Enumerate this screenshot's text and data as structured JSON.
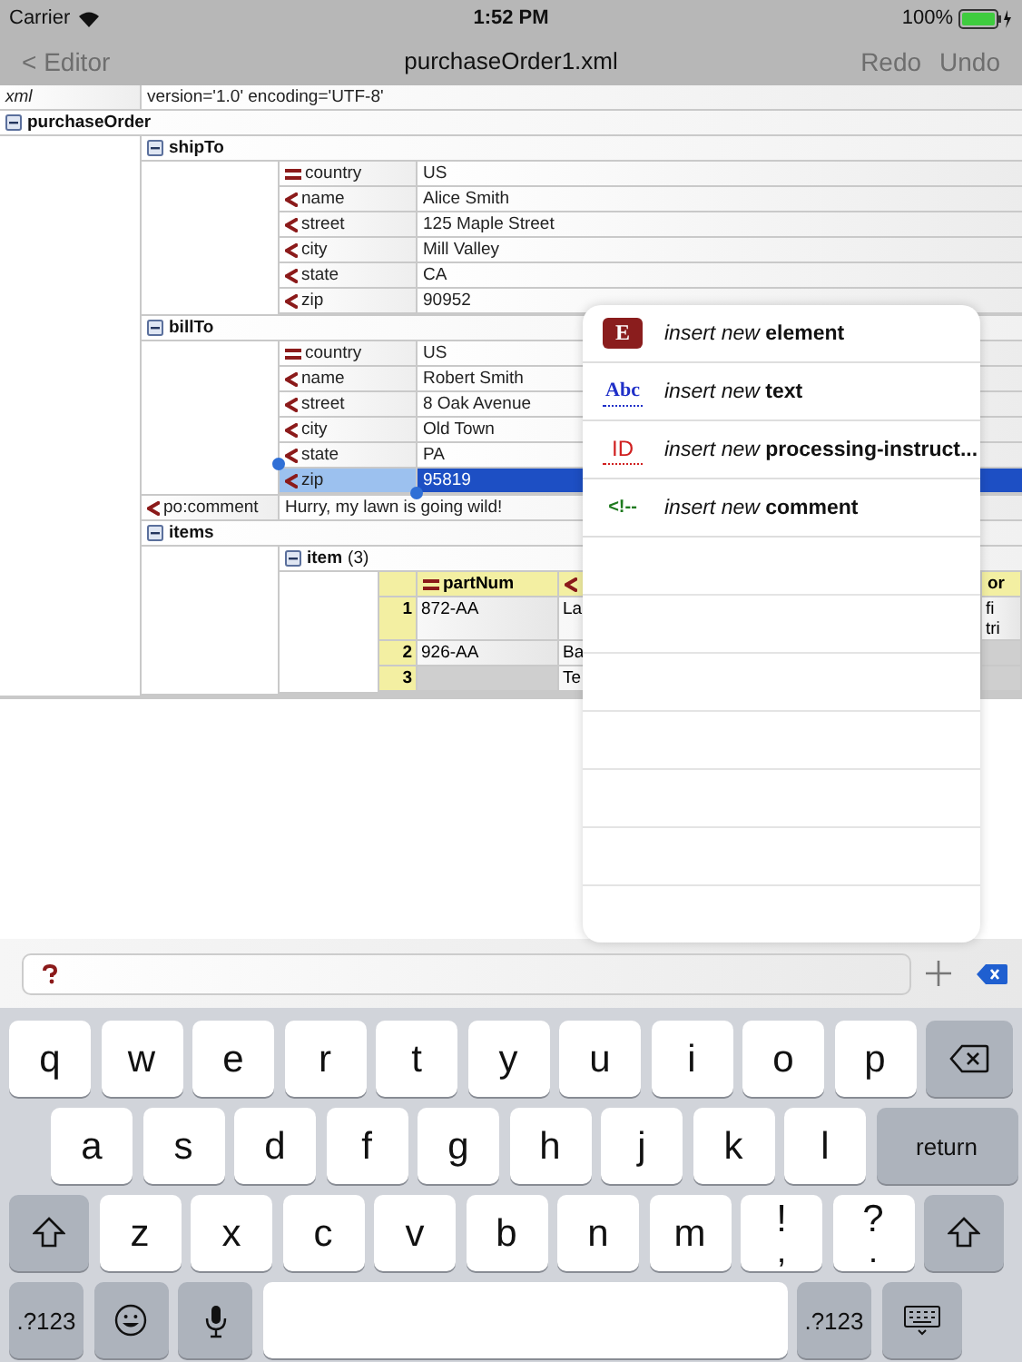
{
  "status_bar": {
    "carrier": "Carrier",
    "time": "1:52 PM",
    "battery": "100%"
  },
  "nav_bar": {
    "back": {
      "label": "< Editor",
      "disabled": true
    },
    "title": "purchaseOrder1.xml",
    "actions": [
      {
        "label": "Redo",
        "disabled": true
      },
      {
        "label": "Undo",
        "disabled": true
      }
    ]
  },
  "document": [
    {
      "kind": "declaration",
      "name": "xml",
      "value": "version='1.0' encoding='UTF-8'",
      "selected": false
    },
    {
      "kind": "element",
      "name": "purchaseOrder",
      "expanded": true,
      "children": [
        {
          "kind": "element",
          "name": "shipTo",
          "expanded": true,
          "children": [
            {
              "kind": "attribute",
              "name": "country",
              "value": "US",
              "selected": false
            },
            {
              "kind": "leaf",
              "name": "name",
              "value": "Alice Smith",
              "selected": false
            },
            {
              "kind": "leaf",
              "name": "street",
              "value": "125 Maple Street",
              "selected": false
            },
            {
              "kind": "leaf",
              "name": "city",
              "value": "Mill Valley",
              "selected": false
            },
            {
              "kind": "leaf",
              "name": "state",
              "value": "CA",
              "selected": false
            },
            {
              "kind": "leaf",
              "name": "zip",
              "value": "90952",
              "selected": false
            }
          ]
        },
        {
          "kind": "element",
          "name": "billTo",
          "expanded": true,
          "children": [
            {
              "kind": "attribute",
              "name": "country",
              "value": "US",
              "selected": false
            },
            {
              "kind": "leaf",
              "name": "name",
              "value": "Robert Smith",
              "selected": false
            },
            {
              "kind": "leaf",
              "name": "street",
              "value": "8 Oak Avenue",
              "selected": false
            },
            {
              "kind": "leaf",
              "name": "city",
              "value": "Old Town",
              "selected": false
            },
            {
              "kind": "leaf",
              "name": "state",
              "value": "PA",
              "selected": false
            },
            {
              "kind": "leaf",
              "name": "zip",
              "value": "95819",
              "selected": true
            }
          ]
        },
        {
          "kind": "leaf",
          "name": "po:comment",
          "value": "Hurry, my lawn is going wild!",
          "selected": false
        },
        {
          "kind": "element",
          "name": "items",
          "expanded": true,
          "children": [
            {
              "kind": "table",
              "name": "item",
              "count": "(3)",
              "expanded": true,
              "columns": [
                {
                  "kind": "attribute",
                  "name": "partNum"
                },
                {
                  "kind": "leaf"
                },
                {
                  "kind": "partial",
                  "name": "or"
                }
              ],
              "rows": [
                {
                  "index": "1",
                  "cells": [
                    "872-AA",
                    "La",
                    "fi\ntri"
                  ]
                },
                {
                  "index": "2",
                  "cells": [
                    "926-AA",
                    "Ba",
                    null
                  ]
                },
                {
                  "index": "3",
                  "cells": [
                    null,
                    "Te",
                    null
                  ]
                }
              ]
            }
          ]
        }
      ]
    }
  ],
  "insert_menu": [
    {
      "kind": "element",
      "icon_text": "E",
      "label": "*insert new* **element**"
    },
    {
      "kind": "text",
      "icon_text": "Abc",
      "label": "*insert new* **text**"
    },
    {
      "kind": "processing",
      "icon_text": "ID",
      "label": "*insert new* **processing-instruct...**"
    },
    {
      "kind": "comment",
      "icon_text": "<!--",
      "label": "*insert new* **comment**"
    }
  ],
  "keyboard": [
    [
      {
        "kind": "letter",
        "label": "q"
      },
      {
        "kind": "letter",
        "label": "w"
      },
      {
        "kind": "letter",
        "label": "e"
      },
      {
        "kind": "letter",
        "label": "r"
      },
      {
        "kind": "letter",
        "label": "t"
      },
      {
        "kind": "letter",
        "label": "y"
      },
      {
        "kind": "letter",
        "label": "u"
      },
      {
        "kind": "letter",
        "label": "i"
      },
      {
        "kind": "letter",
        "label": "o"
      },
      {
        "kind": "letter",
        "label": "p"
      },
      {
        "kind": "backspace"
      }
    ],
    [
      {
        "kind": "letter",
        "label": "a"
      },
      {
        "kind": "letter",
        "label": "s"
      },
      {
        "kind": "letter",
        "label": "d"
      },
      {
        "kind": "letter",
        "label": "f"
      },
      {
        "kind": "letter",
        "label": "g"
      },
      {
        "kind": "letter",
        "label": "h"
      },
      {
        "kind": "letter",
        "label": "j"
      },
      {
        "kind": "letter",
        "label": "k"
      },
      {
        "kind": "letter",
        "label": "l"
      },
      {
        "kind": "return",
        "label": "return"
      }
    ],
    [
      {
        "kind": "shift"
      },
      {
        "kind": "letter",
        "label": "z"
      },
      {
        "kind": "letter",
        "label": "x"
      },
      {
        "kind": "letter",
        "label": "c"
      },
      {
        "kind": "letter",
        "label": "v"
      },
      {
        "kind": "letter",
        "label": "b"
      },
      {
        "kind": "letter",
        "label": "n"
      },
      {
        "kind": "letter",
        "label": "m"
      },
      {
        "kind": "dual",
        "label": "!",
        "sublabel": ","
      },
      {
        "kind": "dual",
        "label": "?",
        "sublabel": "."
      },
      {
        "kind": "shift"
      }
    ],
    [
      {
        "kind": "numbers",
        "label": ".?123"
      },
      {
        "kind": "emoji"
      },
      {
        "kind": "mic"
      },
      {
        "kind": "space"
      },
      {
        "kind": "numbers",
        "label": ".?123"
      },
      {
        "kind": "hide"
      }
    ]
  ]
}
